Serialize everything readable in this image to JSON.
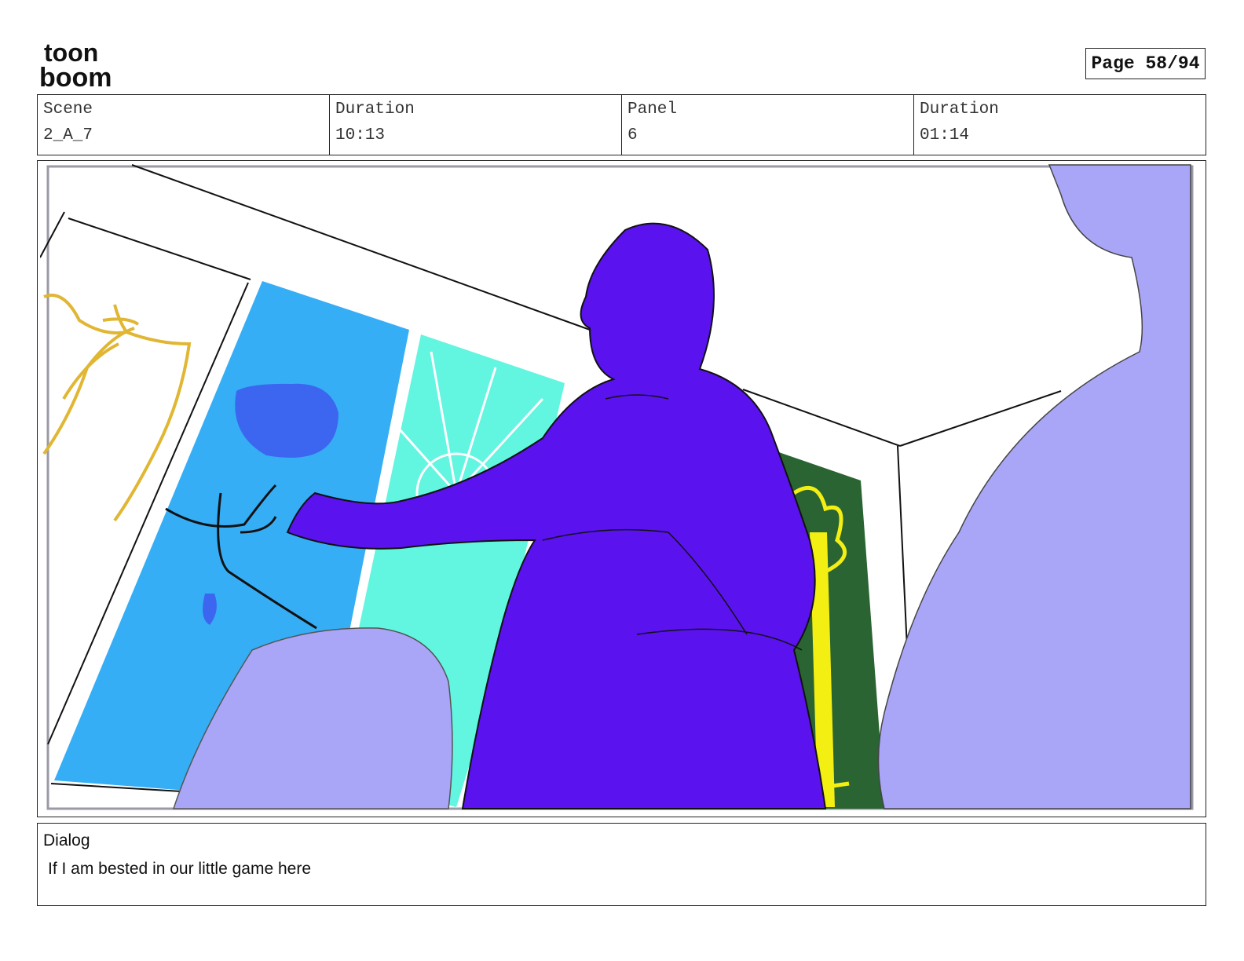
{
  "logo": {
    "line1": "toon",
    "line2": "boom"
  },
  "page": {
    "label": "Page 58/94"
  },
  "header": {
    "scene_label": "Scene",
    "scene_value": "2_A_7",
    "duration_label": "Duration",
    "duration_value": "10:13",
    "panel_label": "Panel",
    "panel_value": "6",
    "panel_duration_label": "Duration",
    "panel_duration_value": "01:14"
  },
  "dialog": {
    "label": "Dialog",
    "text": "If I am bested in our little game here"
  },
  "colors": {
    "purple_figure": "#5a12ee",
    "lavender_figure": "#a9a5f7",
    "blue_window": "#35aef6",
    "cyan_window": "#62f5e0",
    "green_window": "#2a6432",
    "yellow_sketch": "#e0b632",
    "yellow_tree": "#f4ef12"
  }
}
